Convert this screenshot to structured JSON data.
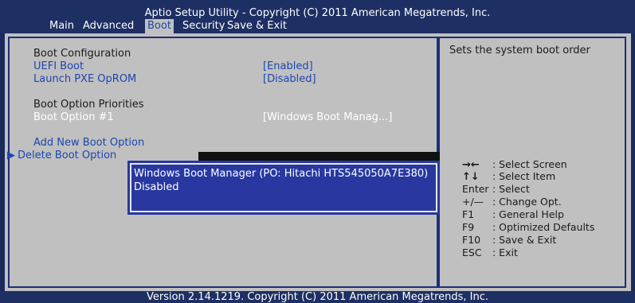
{
  "title": "Aptio Setup Utility - Copyright (C) 2011 American Megatrends, Inc.",
  "menu": {
    "items": [
      "Main",
      "Advanced",
      "Boot",
      "Security",
      "Save & Exit"
    ],
    "active": "Boot"
  },
  "settings": {
    "boot_configuration": "Boot Configuration",
    "uefi_boot_label": "UEFI Boot",
    "uefi_boot_value": "[Enabled]",
    "launch_pxe_label": "Launch PXE OpROM",
    "launch_pxe_value": "[Disabled]",
    "boot_option_priorities": "Boot Option Priorities",
    "boot_option1_label": "Boot Option #1",
    "boot_option1_value": "[Windows Boot Manag...]",
    "add_new_boot_option": "Add New Boot Option",
    "delete_boot_option_marker": "▶",
    "delete_boot_option": "Delete Boot Option"
  },
  "popup": {
    "line1": "Windows Boot Manager (PO: Hitachi HTS545050A7E380)",
    "line2": "Disabled"
  },
  "help": {
    "description": "Sets the system boot order",
    "keys": [
      {
        "key": "→←",
        "desc": ": Select Screen"
      },
      {
        "key": "↑↓",
        "desc": ": Select Item"
      },
      {
        "key": "Enter",
        "desc": ": Select"
      },
      {
        "key": "+/—",
        "desc": ": Change Opt."
      },
      {
        "key": "F1",
        "desc": ": General Help"
      },
      {
        "key": "F9",
        "desc": ": Optimized Defaults"
      },
      {
        "key": "F10",
        "desc": ": Save & Exit"
      },
      {
        "key": "ESC",
        "desc": ": Exit"
      }
    ]
  },
  "footer": "Version 2.14.1219. Copyright (C) 2011 American Megatrends, Inc.",
  "colors": {
    "header_bg": "#1e2f63",
    "panel_bg": "#c0c0c0",
    "accent_blue": "#1c46b0",
    "popup_bg": "#2838a0"
  }
}
